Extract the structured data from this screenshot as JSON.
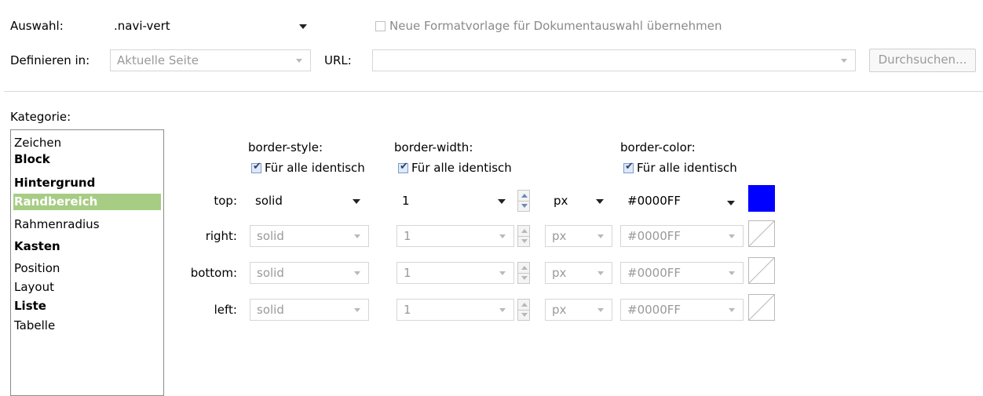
{
  "header": {
    "auswahl_label": "Auswahl:",
    "auswahl_value": ".navi-vert",
    "neue_format_label": "Neue Formatvorlage für Dokumentauswahl übernehmen",
    "definieren_label": "Definieren in:",
    "definieren_value": "Aktuelle Seite",
    "url_label": "URL:",
    "url_value": "",
    "browse_label": "Durchsuchen..."
  },
  "kategorie": {
    "label": "Kategorie:",
    "items": [
      {
        "label": "Zeichen",
        "bold": false,
        "selected": false
      },
      {
        "label": "Block",
        "bold": true,
        "selected": false
      },
      {
        "label": "Hintergrund",
        "bold": true,
        "selected": false
      },
      {
        "label": "Randbereich",
        "bold": true,
        "selected": true
      },
      {
        "label": "Rahmenradius",
        "bold": false,
        "selected": false
      },
      {
        "label": "Kasten",
        "bold": true,
        "selected": false
      },
      {
        "label": "Position",
        "bold": false,
        "selected": false
      },
      {
        "label": "Layout",
        "bold": false,
        "selected": false
      },
      {
        "label": "Liste",
        "bold": true,
        "selected": false
      },
      {
        "label": "Tabelle",
        "bold": false,
        "selected": false
      }
    ]
  },
  "border": {
    "style_header": "border-style:",
    "width_header": "border-width:",
    "color_header": "border-color:",
    "same_label": "Für alle identisch",
    "rows": [
      {
        "side": "top:",
        "style": "solid",
        "width": "1",
        "unit": "px",
        "color": "#0000FF",
        "swatch": "#0000FF",
        "enabled": true
      },
      {
        "side": "right:",
        "style": "solid",
        "width": "1",
        "unit": "px",
        "color": "#0000FF",
        "swatch": "none",
        "enabled": false
      },
      {
        "side": "bottom:",
        "style": "solid",
        "width": "1",
        "unit": "px",
        "color": "#0000FF",
        "swatch": "none",
        "enabled": false
      },
      {
        "side": "left:",
        "style": "solid",
        "width": "1",
        "unit": "px",
        "color": "#0000FF",
        "swatch": "none",
        "enabled": false
      }
    ]
  },
  "colors": {
    "selection_bg": "#A7CC84",
    "swatch_blue": "#0000FF"
  }
}
